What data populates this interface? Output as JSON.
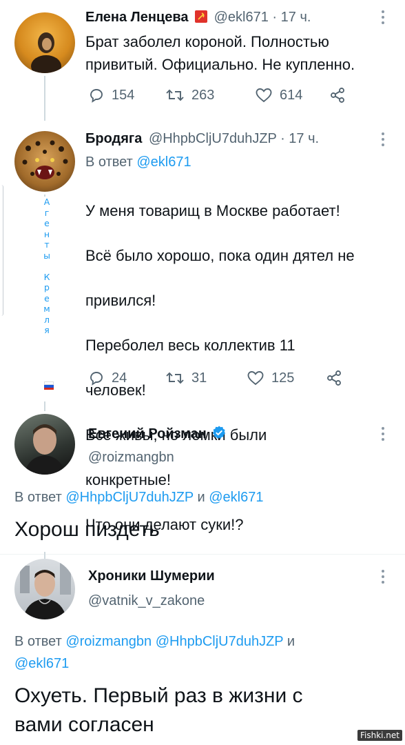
{
  "tweets": [
    {
      "name": "Елена Ленцева",
      "handle": "@ekl671",
      "time": "· 17 ч.",
      "flag_icon": "hammer-sickle-icon",
      "text": "Брат заболел короной. Полностью привитый. Официально. Не купленно.",
      "replies": "154",
      "retweets": "263",
      "likes": "614"
    },
    {
      "name": "Бродяга",
      "handle": "@HhpbCljU7duhJZP",
      "time": "· 17 ч.",
      "reply_prefix": "В ответ",
      "reply_to": "@ekl671",
      "text_lines": [
        "У меня товарищ в Москве работает!",
        "Всё было хорошо, пока один дятел не",
        "привился!",
        "Переболел весь коллектив 11",
        "человек!",
        "Все живы, но ломки были",
        "конкретные!",
        "Что они делают суки!?"
      ],
      "replies": "24",
      "retweets": "31",
      "likes": "125",
      "sidebar_label_letters": [
        "А",
        "г",
        "е",
        "н",
        "т",
        "ы",
        " ",
        "К",
        "р",
        "е",
        "м",
        "л",
        "я"
      ]
    },
    {
      "name": "Евгений Ройзман",
      "handle": "@roizmangbn",
      "verified": true,
      "reply_prefix": "В ответ",
      "reply_to_1": "@HhpbCljU7duhJZP",
      "reply_and": "и",
      "reply_to_2": "@ekl671",
      "text": "Хорош пиздеть"
    },
    {
      "name": "Хроники Шумерии",
      "handle": "@vatnik_v_zakone",
      "reply_prefix": "В ответ",
      "reply_to_1": "@roizmangbn",
      "reply_to_2": "@HhpbCljU7duhJZP",
      "reply_and": "и",
      "reply_to_3": "@ekl671",
      "text_line_1": "Охуеть. Первый раз в жизни с",
      "text_line_2": "вами согласен"
    }
  ],
  "watermark": "Fishki.net",
  "colors": {
    "accent": "#1d9bf0",
    "muted": "#536471",
    "text": "#0f1419"
  }
}
